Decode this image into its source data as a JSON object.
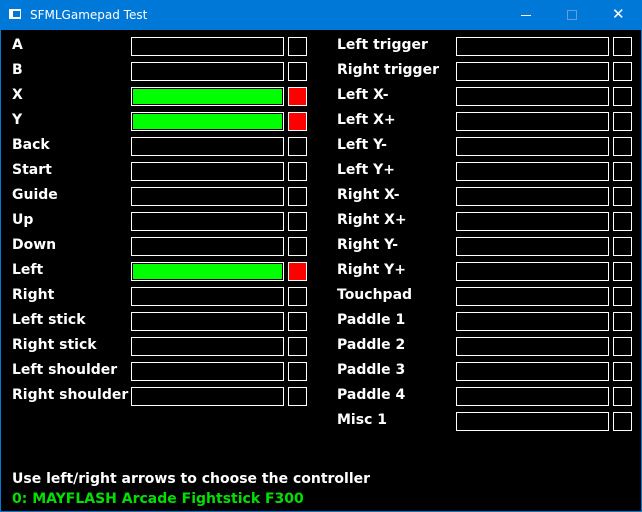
{
  "window": {
    "title": "SFMLGamepad Test",
    "controls": {
      "minimize": "minimize",
      "maximize": "maximize",
      "close": "close"
    }
  },
  "colors": {
    "pressed_bar": "#00ff00",
    "pressed_square": "#ff0000",
    "controller_text": "#00e000",
    "titlebar": "#0078d7"
  },
  "left_inputs": [
    {
      "label": "A",
      "pressed": false,
      "value": 0
    },
    {
      "label": "B",
      "pressed": false,
      "value": 0
    },
    {
      "label": "X",
      "pressed": true,
      "value": 1
    },
    {
      "label": "Y",
      "pressed": true,
      "value": 1
    },
    {
      "label": "Back",
      "pressed": false,
      "value": 0
    },
    {
      "label": "Start",
      "pressed": false,
      "value": 0
    },
    {
      "label": "Guide",
      "pressed": false,
      "value": 0
    },
    {
      "label": "Up",
      "pressed": false,
      "value": 0
    },
    {
      "label": "Down",
      "pressed": false,
      "value": 0
    },
    {
      "label": "Left",
      "pressed": true,
      "value": 1
    },
    {
      "label": "Right",
      "pressed": false,
      "value": 0
    },
    {
      "label": "Left stick",
      "pressed": false,
      "value": 0
    },
    {
      "label": "Right stick",
      "pressed": false,
      "value": 0
    },
    {
      "label": "Left shoulder",
      "pressed": false,
      "value": 0
    },
    {
      "label": "Right shoulder",
      "pressed": false,
      "value": 0
    }
  ],
  "right_inputs": [
    {
      "label": "Left trigger",
      "pressed": false,
      "value": 0
    },
    {
      "label": "Right trigger",
      "pressed": false,
      "value": 0
    },
    {
      "label": "Left X-",
      "pressed": false,
      "value": 0
    },
    {
      "label": "Left X+",
      "pressed": false,
      "value": 0
    },
    {
      "label": "Left Y-",
      "pressed": false,
      "value": 0
    },
    {
      "label": "Left Y+",
      "pressed": false,
      "value": 0
    },
    {
      "label": "Right X-",
      "pressed": false,
      "value": 0
    },
    {
      "label": "Right X+",
      "pressed": false,
      "value": 0
    },
    {
      "label": "Right Y-",
      "pressed": false,
      "value": 0
    },
    {
      "label": "Right Y+",
      "pressed": false,
      "value": 0
    },
    {
      "label": "Touchpad",
      "pressed": false,
      "value": 0
    },
    {
      "label": "Paddle 1",
      "pressed": false,
      "value": 0
    },
    {
      "label": "Paddle 2",
      "pressed": false,
      "value": 0
    },
    {
      "label": "Paddle 3",
      "pressed": false,
      "value": 0
    },
    {
      "label": "Paddle 4",
      "pressed": false,
      "value": 0
    },
    {
      "label": "Misc 1",
      "pressed": false,
      "value": 0
    }
  ],
  "footer": {
    "hint": "Use left/right arrows to choose the controller",
    "controller": "0: MAYFLASH Arcade Fightstick F300"
  }
}
